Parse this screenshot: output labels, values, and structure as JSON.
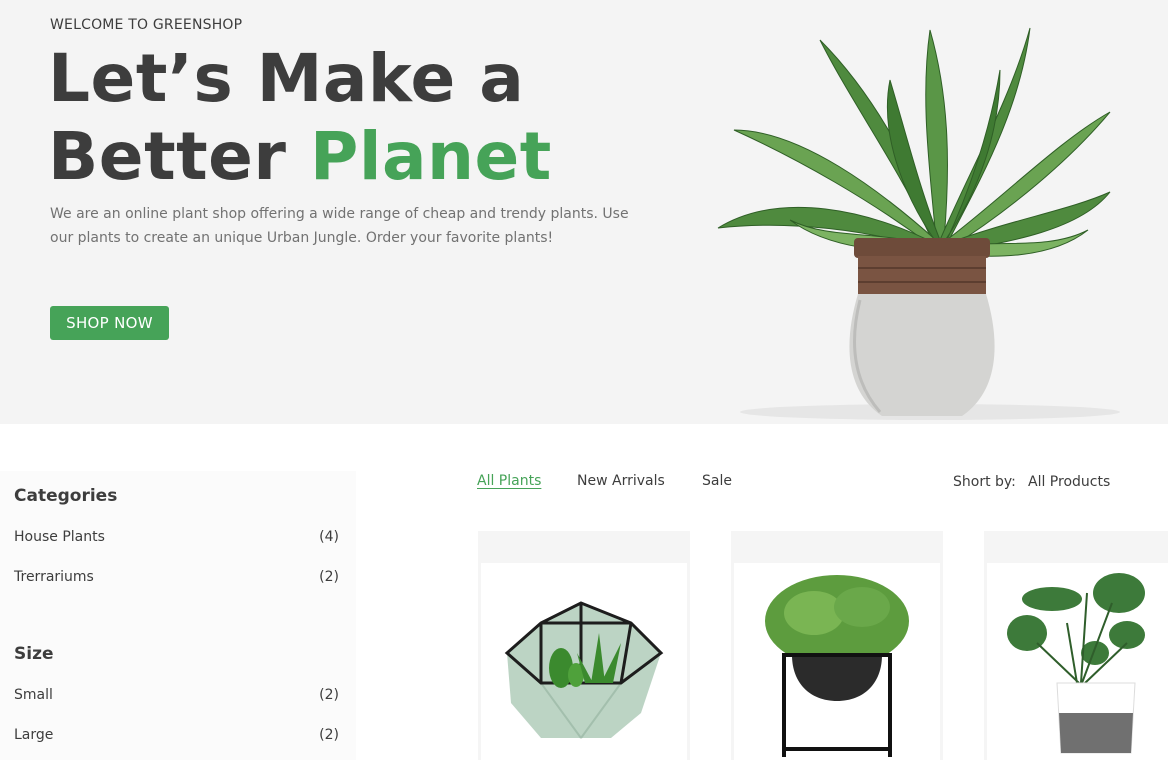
{
  "hero": {
    "welcome": "WELCOME TO GREENSHOP",
    "title_line1": "Let’s Make a",
    "title_line2_a": "Better ",
    "title_line2_b": "Planet",
    "description": "We are an online plant shop offering a wide range of cheap and trendy plants. Use our plants to create an unique Urban Jungle. Order your favorite plants!",
    "cta": "SHOP NOW"
  },
  "sidebar": {
    "categories_heading": "Categories",
    "categories": [
      {
        "label": "House Plants",
        "count": "(4)"
      },
      {
        "label": "Trerrariums",
        "count": "(2)"
      }
    ],
    "size_heading": "Size",
    "sizes": [
      {
        "label": "Small",
        "count": "(2)"
      },
      {
        "label": "Large",
        "count": "(2)"
      }
    ]
  },
  "tabs": [
    "All Plants",
    "New Arrivals",
    "Sale"
  ],
  "sort": {
    "label": "Short by:",
    "value": "All Products"
  },
  "colors": {
    "accent": "#46a358",
    "text": "#3d3d3d",
    "muted": "#727272",
    "hero_bg": "#f4f4f4"
  }
}
